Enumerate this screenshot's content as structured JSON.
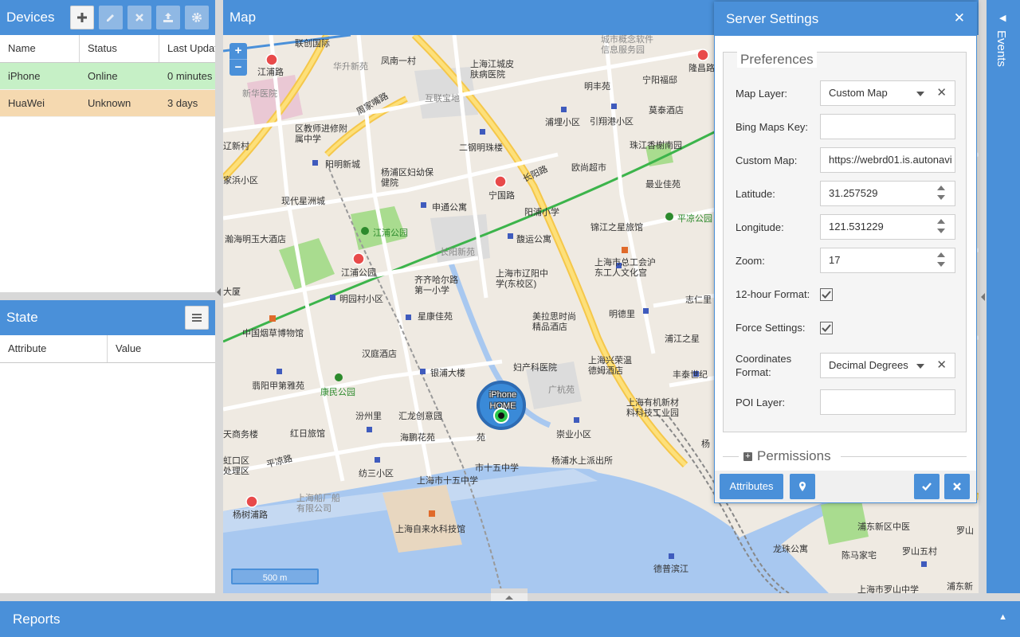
{
  "devices": {
    "title": "Devices",
    "toolbar": [
      "add-icon",
      "edit-icon",
      "remove-icon",
      "upload-icon",
      "gear-icon"
    ],
    "columns": [
      "Name",
      "Status",
      "Last Update"
    ],
    "rows": [
      {
        "name": "iPhone",
        "status": "Online",
        "last_update": "0 minutes"
      },
      {
        "name": "HuaWei",
        "status": "Unknown",
        "last_update": "3 days"
      }
    ]
  },
  "state": {
    "title": "State",
    "columns": [
      "Attribute",
      "Value"
    ]
  },
  "map": {
    "title": "Map",
    "zoom_in": "+",
    "zoom_out": "−",
    "scale": "500 m",
    "marker": {
      "line1": "iPhone",
      "line2": "HOME"
    },
    "labels": [
      {
        "text": "联创国际",
        "cls": ""
      },
      {
        "text": "江浦路",
        "cls": ""
      },
      {
        "text": "新华医院",
        "cls": "gray"
      },
      {
        "text": "华升新苑",
        "cls": "gray"
      },
      {
        "text": "凤南一村",
        "cls": ""
      },
      {
        "text": "上海江城皮肤病医院",
        "cls": ""
      },
      {
        "text": "城市概念软件信息服务园",
        "cls": "gray"
      },
      {
        "text": "隆昌路",
        "cls": ""
      },
      {
        "text": "明丰苑",
        "cls": ""
      },
      {
        "text": "宁阳福邸",
        "cls": ""
      },
      {
        "text": "互联宝地",
        "cls": "gray"
      },
      {
        "text": "周家嘴路",
        "cls": ""
      },
      {
        "text": "莫泰酒店",
        "cls": ""
      },
      {
        "text": "浦埋小区",
        "cls": ""
      },
      {
        "text": "引翔港小区",
        "cls": ""
      },
      {
        "text": "区教师进修附属中学",
        "cls": ""
      },
      {
        "text": "辽新村",
        "cls": ""
      },
      {
        "text": "二钢明珠楼",
        "cls": ""
      },
      {
        "text": "珠江香榭南园",
        "cls": ""
      },
      {
        "text": "阳明新城",
        "cls": ""
      },
      {
        "text": "欧尚超市",
        "cls": ""
      },
      {
        "text": "杨浦区妇幼保健院",
        "cls": ""
      },
      {
        "text": "最业佳苑",
        "cls": ""
      },
      {
        "text": "家浜小区",
        "cls": ""
      },
      {
        "text": "宁国路",
        "cls": ""
      },
      {
        "text": "现代星洲城",
        "cls": ""
      },
      {
        "text": "申通公寓",
        "cls": ""
      },
      {
        "text": "阳浦小学",
        "cls": ""
      },
      {
        "text": "平凉公园",
        "cls": "green"
      },
      {
        "text": "锦江之星旅馆",
        "cls": ""
      },
      {
        "text": "江浦公园",
        "cls": "green"
      },
      {
        "text": "瀚海明玉大酒店",
        "cls": ""
      },
      {
        "text": "长阳新苑",
        "cls": "gray"
      },
      {
        "text": "馥运公寓",
        "cls": ""
      },
      {
        "text": "上海市总工会沪东工人文化宫",
        "cls": ""
      },
      {
        "text": "江浦公园",
        "cls": ""
      },
      {
        "text": "上海市辽阳中学(东校区)",
        "cls": ""
      },
      {
        "text": "齐齐哈尔路第一小学",
        "cls": ""
      },
      {
        "text": "大厦",
        "cls": ""
      },
      {
        "text": "明园村小区",
        "cls": ""
      },
      {
        "text": "志仁里",
        "cls": ""
      },
      {
        "text": "明德里",
        "cls": ""
      },
      {
        "text": "中国烟草博物馆",
        "cls": ""
      },
      {
        "text": "星康佳苑",
        "cls": ""
      },
      {
        "text": "美拉思时尚精品酒店",
        "cls": ""
      },
      {
        "text": "浦江之星",
        "cls": ""
      },
      {
        "text": "汉庭酒店",
        "cls": ""
      },
      {
        "text": "妇产科医院",
        "cls": ""
      },
      {
        "text": "上海兴荣温德姆酒店",
        "cls": ""
      },
      {
        "text": "银浦大楼",
        "cls": ""
      },
      {
        "text": "丰泰世纪",
        "cls": ""
      },
      {
        "text": "翡阳甲第雅苑",
        "cls": ""
      },
      {
        "text": "康民公园",
        "cls": "green"
      },
      {
        "text": "广杭苑",
        "cls": "gray"
      },
      {
        "text": "上海有机新材料科技工业园",
        "cls": ""
      },
      {
        "text": "汾州里",
        "cls": ""
      },
      {
        "text": "汇龙创意园",
        "cls": ""
      },
      {
        "text": "天商务楼",
        "cls": ""
      },
      {
        "text": "红日旅馆",
        "cls": ""
      },
      {
        "text": "海鹏花苑",
        "cls": ""
      },
      {
        "text": "苑",
        "cls": ""
      },
      {
        "text": "崇业小区",
        "cls": ""
      },
      {
        "text": "虹口区处理区",
        "cls": ""
      },
      {
        "text": "纺三小区",
        "cls": ""
      },
      {
        "text": "上海市十五中学",
        "cls": ""
      },
      {
        "text": "市十五中学",
        "cls": ""
      },
      {
        "text": "杨浦水上派出所",
        "cls": ""
      },
      {
        "text": "上海船厂船有限公司",
        "cls": "gray"
      },
      {
        "text": "杨树浦路",
        "cls": ""
      },
      {
        "text": "上海自来水科技馆",
        "cls": ""
      },
      {
        "text": "浦东新区中医",
        "cls": ""
      },
      {
        "text": "罗山",
        "cls": ""
      },
      {
        "text": "龙珠公寓",
        "cls": ""
      },
      {
        "text": "陈马家宅",
        "cls": ""
      },
      {
        "text": "罗山五村",
        "cls": ""
      },
      {
        "text": "德普滨江",
        "cls": ""
      },
      {
        "text": "上海市罗山中学",
        "cls": ""
      },
      {
        "text": "浦东新",
        "cls": ""
      },
      {
        "text": "长阳路",
        "cls": ""
      },
      {
        "text": "平凉路",
        "cls": ""
      },
      {
        "text": "杨",
        "cls": ""
      }
    ]
  },
  "events": {
    "title": "Events"
  },
  "reports": {
    "title": "Reports"
  },
  "dialog": {
    "title": "Server Settings",
    "section": "Preferences",
    "fields": {
      "map_layer": {
        "label": "Map Layer:",
        "value": "Custom Map"
      },
      "bing_key": {
        "label": "Bing Maps Key:",
        "value": ""
      },
      "custom_map": {
        "label": "Custom Map:",
        "value": "https://webrd01.is.autonavi"
      },
      "latitude": {
        "label": "Latitude:",
        "value": "31.257529"
      },
      "longitude": {
        "label": "Longitude:",
        "value": "121.531229"
      },
      "zoom": {
        "label": "Zoom:",
        "value": "17"
      },
      "twelve_hour": {
        "label": "12-hour Format:",
        "checked": true
      },
      "force": {
        "label": "Force Settings:",
        "checked": true
      },
      "coords": {
        "label": "Coordinates Format:",
        "value": "Decimal Degrees"
      },
      "poi": {
        "label": "POI Layer:",
        "value": ""
      }
    },
    "permissions": "Permissions",
    "attributes_button": "Attributes"
  }
}
